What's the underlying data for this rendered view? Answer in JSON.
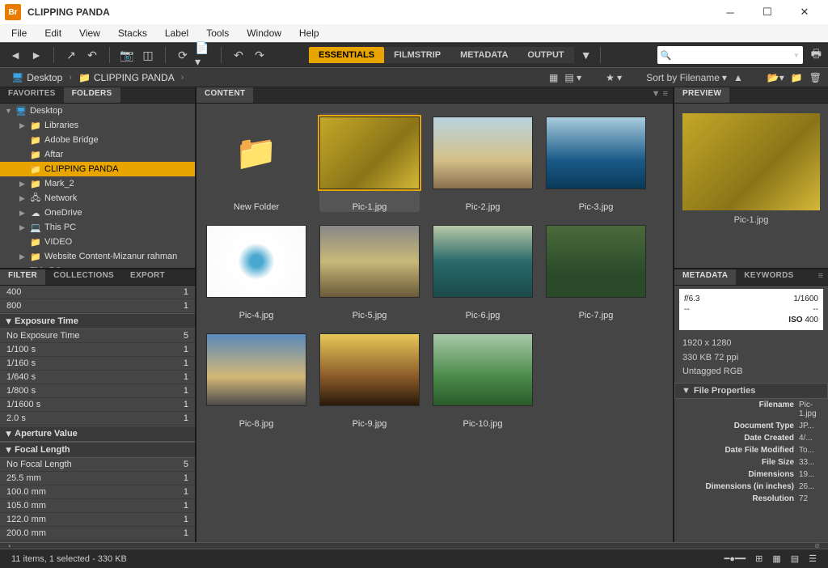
{
  "app": {
    "icon_text": "Br",
    "title": "CLIPPING PANDA"
  },
  "menu": [
    "File",
    "Edit",
    "View",
    "Stacks",
    "Label",
    "Tools",
    "Window",
    "Help"
  ],
  "workspaces": [
    {
      "label": "ESSENTIALS",
      "active": true
    },
    {
      "label": "FILMSTRIP",
      "active": false
    },
    {
      "label": "METADATA",
      "active": false
    },
    {
      "label": "OUTPUT",
      "active": false
    }
  ],
  "search_placeholder": "",
  "path": {
    "root": "Desktop",
    "current": "CLIPPING PANDA"
  },
  "sort_label": "Sort by Filename",
  "left_tabs_top": [
    "FAVORITES",
    "FOLDERS"
  ],
  "left_tabs_mid": [
    "FILTER",
    "COLLECTIONS",
    "EXPORT"
  ],
  "tree": [
    {
      "label": "Desktop",
      "icon": "desktop",
      "indent": 0,
      "arrow": "▼"
    },
    {
      "label": "Libraries",
      "icon": "folder",
      "indent": 1,
      "arrow": "▶"
    },
    {
      "label": "Adobe Bridge",
      "icon": "folder",
      "indent": 1,
      "arrow": ""
    },
    {
      "label": "Aftar",
      "icon": "folder",
      "indent": 1,
      "arrow": ""
    },
    {
      "label": "CLIPPING PANDA",
      "icon": "folder",
      "indent": 1,
      "arrow": "",
      "selected": true
    },
    {
      "label": "Mark_2",
      "icon": "folder",
      "indent": 1,
      "arrow": "▶"
    },
    {
      "label": "Network",
      "icon": "network",
      "indent": 1,
      "arrow": "▶"
    },
    {
      "label": "OneDrive",
      "icon": "cloud",
      "indent": 1,
      "arrow": "▶"
    },
    {
      "label": "This PC",
      "icon": "pc",
      "indent": 1,
      "arrow": "▶"
    },
    {
      "label": "VIDEO",
      "icon": "folder",
      "indent": 1,
      "arrow": ""
    },
    {
      "label": "Website Content-Mizanur rahman",
      "icon": "folder",
      "indent": 1,
      "arrow": "▶"
    },
    {
      "label": "This PC",
      "icon": "pc",
      "indent": 0,
      "arrow": "▶"
    }
  ],
  "filter": {
    "iso": [
      {
        "k": "400",
        "v": "1"
      },
      {
        "k": "800",
        "v": "1"
      }
    ],
    "sections": [
      {
        "title": "Exposure Time",
        "rows": [
          {
            "k": "No Exposure Time",
            "v": "5"
          },
          {
            "k": "1/100 s",
            "v": "1"
          },
          {
            "k": "1/160 s",
            "v": "1"
          },
          {
            "k": "1/640 s",
            "v": "1"
          },
          {
            "k": "1/800 s",
            "v": "1"
          },
          {
            "k": "1/1600 s",
            "v": "1"
          },
          {
            "k": "2.0 s",
            "v": "1"
          }
        ]
      },
      {
        "title": "Aperture Value",
        "rows": []
      },
      {
        "title": "Focal Length",
        "rows": [
          {
            "k": "No Focal Length",
            "v": "5"
          },
          {
            "k": "25.5 mm",
            "v": "1"
          },
          {
            "k": "100.0 mm",
            "v": "1"
          },
          {
            "k": "105.0 mm",
            "v": "1"
          },
          {
            "k": "122.0 mm",
            "v": "1"
          },
          {
            "k": "200.0 mm",
            "v": "1"
          }
        ]
      }
    ]
  },
  "content": {
    "title": "CONTENT",
    "items": [
      {
        "label": "New Folder",
        "type": "folder"
      },
      {
        "label": "Pic-1.jpg",
        "type": "img",
        "cls": "t1",
        "selected": true
      },
      {
        "label": "Pic-2.jpg",
        "type": "img",
        "cls": "t2"
      },
      {
        "label": "Pic-3.jpg",
        "type": "img",
        "cls": "t3"
      },
      {
        "label": "Pic-4.jpg",
        "type": "img",
        "cls": "t4"
      },
      {
        "label": "Pic-5.jpg",
        "type": "img",
        "cls": "t5"
      },
      {
        "label": "Pic-6.jpg",
        "type": "img",
        "cls": "t6"
      },
      {
        "label": "Pic-7.jpg",
        "type": "img",
        "cls": "t7"
      },
      {
        "label": "Pic-8.jpg",
        "type": "img",
        "cls": "t8"
      },
      {
        "label": "Pic-9.jpg",
        "type": "img",
        "cls": "t9"
      },
      {
        "label": "Pic-10.jpg",
        "type": "img",
        "cls": "t10"
      }
    ]
  },
  "preview": {
    "title": "PREVIEW",
    "label": "Pic-1.jpg"
  },
  "metadata_tabs": [
    "METADATA",
    "KEYWORDS"
  ],
  "meta_box": {
    "aperture": "6.3",
    "shutter": "1/1600",
    "awb": "--",
    "ev": "--",
    "iso_label": "ISO",
    "iso": "400"
  },
  "info": {
    "dimensions": "1920 x 1280",
    "size_ppi": "330 KB    72 ppi",
    "colorspace": "Untagged RGB"
  },
  "props": {
    "title": "File Properties",
    "rows": [
      {
        "k": "Filename",
        "v": "Pic-1.jpg"
      },
      {
        "k": "Document Type",
        "v": "JP..."
      },
      {
        "k": "Date Created",
        "v": "4/..."
      },
      {
        "k": "Date File Modified",
        "v": "To..."
      },
      {
        "k": "File Size",
        "v": "33..."
      },
      {
        "k": "Dimensions",
        "v": "19..."
      },
      {
        "k": "Dimensions (in inches)",
        "v": "26..."
      },
      {
        "k": "Resolution",
        "v": "72"
      }
    ]
  },
  "status": "11 items, 1 selected - 330 KB"
}
